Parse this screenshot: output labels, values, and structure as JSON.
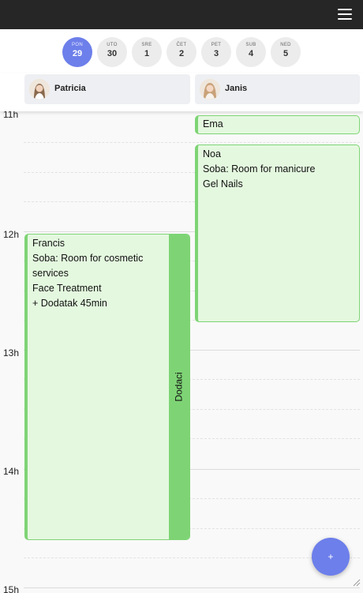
{
  "days": [
    {
      "name": "PON",
      "date": "29"
    },
    {
      "name": "UTO",
      "date": "30"
    },
    {
      "name": "SRE",
      "date": "1"
    },
    {
      "name": "ČET",
      "date": "2"
    },
    {
      "name": "PET",
      "date": "3"
    },
    {
      "name": "SUB",
      "date": "4"
    },
    {
      "name": "NED",
      "date": "5"
    }
  ],
  "staff": [
    {
      "name": "Patricia"
    },
    {
      "name": "Janis"
    }
  ],
  "hours": [
    "11h",
    "12h",
    "13h",
    "14h",
    "15h"
  ],
  "appointments": {
    "ema": {
      "client": "Ema"
    },
    "noa": {
      "client": "Noa",
      "room": "Soba: Room for manicure",
      "service": "Gel Nails"
    },
    "francis": {
      "client": "Francis",
      "room": "Soba: Room for cosmetic services",
      "service": "Face Treatment",
      "addon": "+ Dodatak 45min",
      "extras_label": "Dodaci"
    }
  },
  "fab_label": "+",
  "colors": {
    "accent": "#6d7fea",
    "appointment_fill": "#e4f8df",
    "appointment_border": "#7ed475",
    "topbar": "#262626"
  }
}
